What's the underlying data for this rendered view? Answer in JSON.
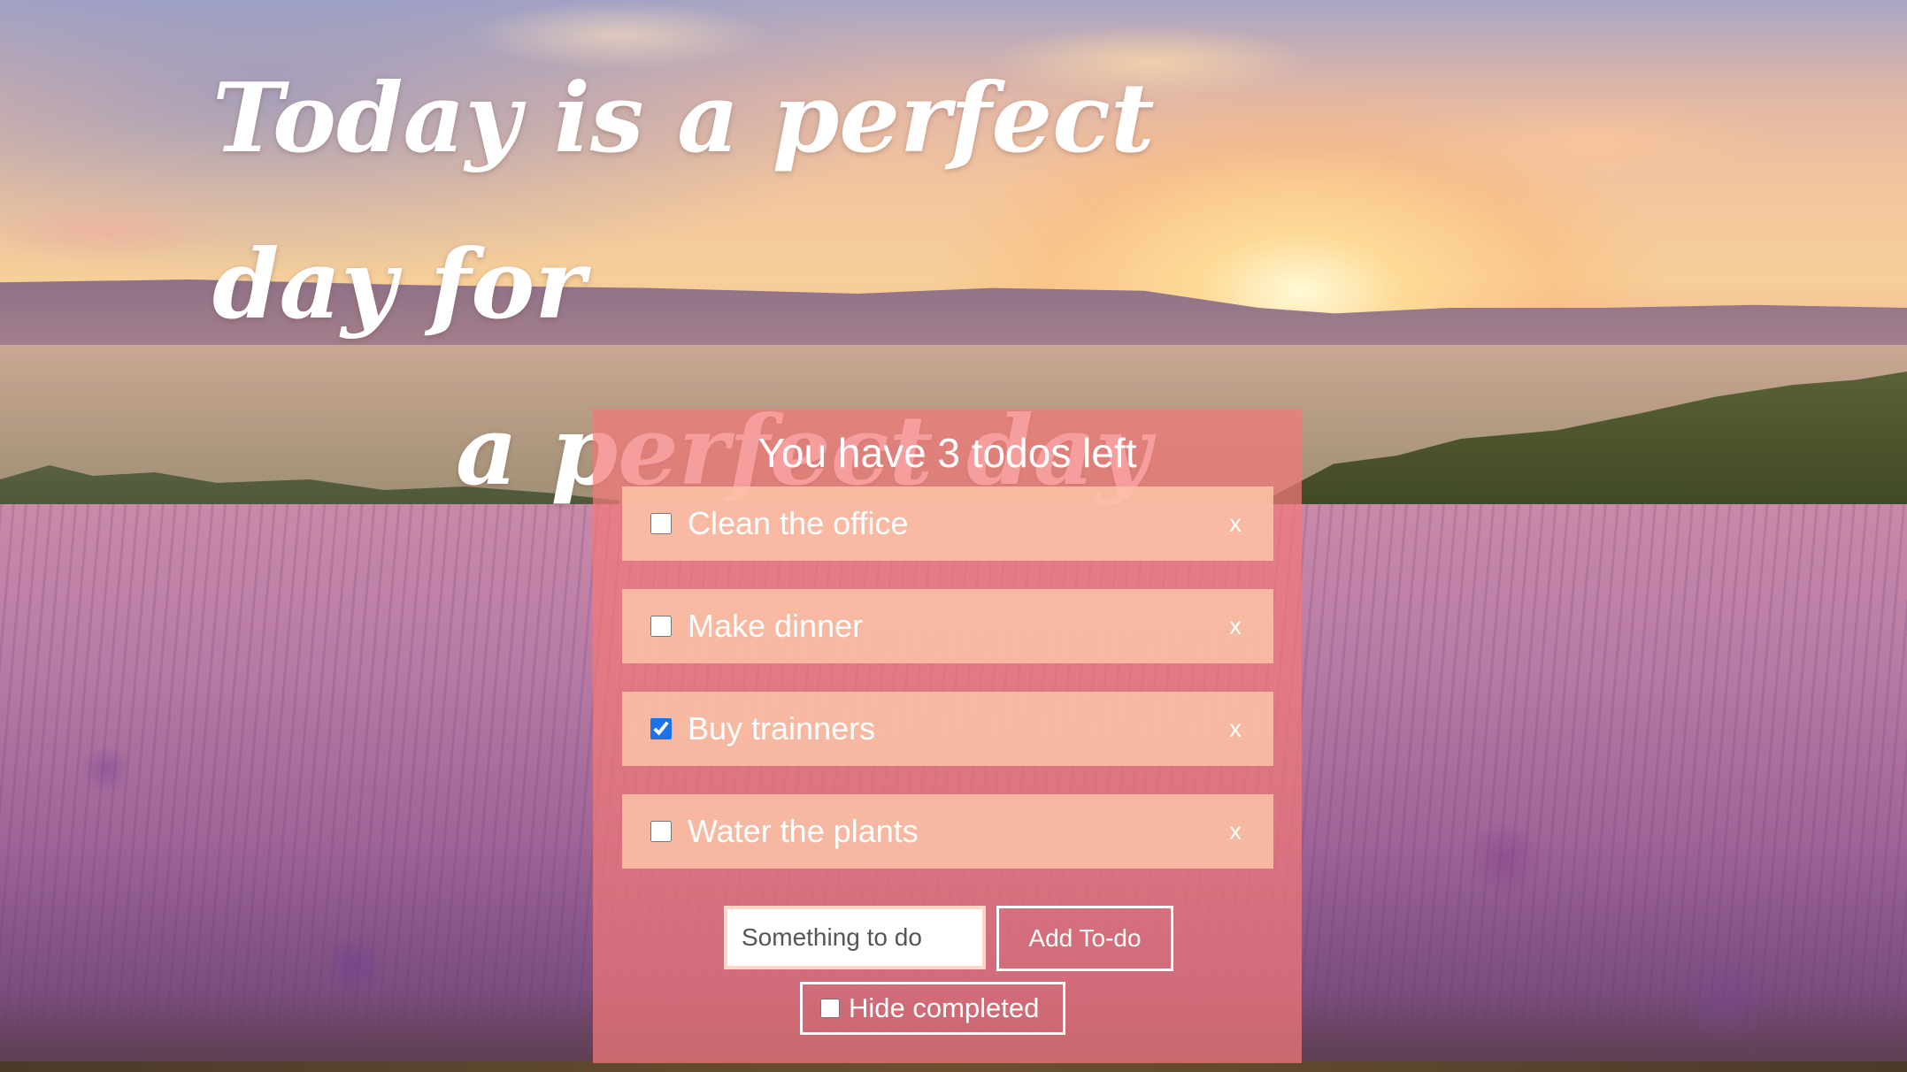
{
  "headline": {
    "line1": "Today is a perfect day for",
    "line2": "a perfect day"
  },
  "panel": {
    "title": "You have 3 todos left",
    "todos": [
      {
        "label": "Clean the office",
        "completed": false,
        "delete_label": "x"
      },
      {
        "label": "Make dinner",
        "completed": false,
        "delete_label": "x"
      },
      {
        "label": "Buy trainners",
        "completed": true,
        "delete_label": "x"
      },
      {
        "label": "Water the plants",
        "completed": false,
        "delete_label": "x"
      }
    ],
    "input": {
      "placeholder": "Something to do",
      "value": ""
    },
    "add_button_label": "Add To-do",
    "hide_completed": {
      "label": "Hide completed",
      "checked": false
    }
  },
  "colors": {
    "panel_bg": "#f27878",
    "todo_item_bg": "#fbc4a8",
    "checkbox_accent": "#1a73e8",
    "text": "#ffffff"
  }
}
